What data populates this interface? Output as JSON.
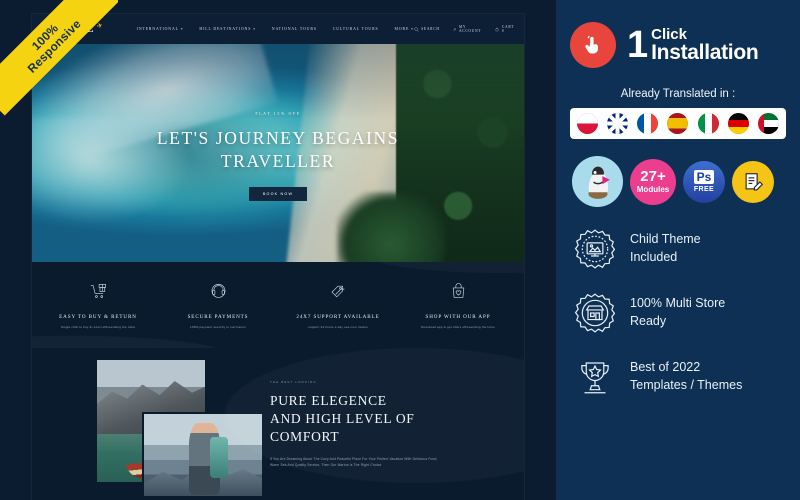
{
  "ribbon": {
    "line1": "100%",
    "line2": "Responsive"
  },
  "preview": {
    "header": {
      "logo_text": "TRAVEL",
      "logo_sub": "ONLINE STORE",
      "logo_icon": "airplane-icon",
      "nav": [
        {
          "label": "INTERNATIONAL",
          "has_caret": true
        },
        {
          "label": "HILL DESTINATIONS",
          "has_caret": true
        },
        {
          "label": "NATIONAL TOURS",
          "has_caret": false
        },
        {
          "label": "CULTURAL TOURS",
          "has_caret": false
        },
        {
          "label": "MORE",
          "has_caret": true
        }
      ],
      "tools": [
        {
          "label": "SEARCH",
          "icon": "search-icon"
        },
        {
          "label": "MY ACCOUNT",
          "icon": "user-icon"
        },
        {
          "label": "CART 0",
          "icon": "cart-icon"
        }
      ]
    },
    "hero": {
      "kicker": "FLAT 15% OFF",
      "title_line1": "LET'S JOURNEY BEGAINS",
      "title_line2": "TRAVELLER",
      "button": "BOOK NOW"
    },
    "features": [
      {
        "icon": "cart-gift-icon",
        "title": "EASY TO BUY & RETURN",
        "desc": "Single click to buy & return efficeending the lutus"
      },
      {
        "icon": "headset-icon",
        "title": "SECURE PAYMENTS",
        "desc": "100% payment security in mel harum"
      },
      {
        "icon": "tags-icon",
        "title": "24X7 SUPPORT AVAILABLE",
        "desc": "support 24 hours a day sea cum modus"
      },
      {
        "icon": "shopping-bag-heart-icon",
        "title": "SHOP WITH OUR APP",
        "desc": "Download app & get offers efficeending the lutus"
      }
    ],
    "about": {
      "kicker": "THE BEST LOOKING",
      "title_line1": "PURE ELEGENCE",
      "title_line2": "AND HIGH LEVEL OF",
      "title_line3": "COMFORT",
      "body": "If You Are Dreaming About The Cozy And Peaceful Place For Your Perfect Vacation With Delicious Food, Warm Sea And Quality Service, Then Our Marina Is The Right Choice.",
      "image1_alt": "mountain-lake-boat-photo",
      "image2_alt": "hiker-with-backpack-photo"
    }
  },
  "panel": {
    "background_color": "#0e3054",
    "one_click": {
      "icon": "click-hand-icon",
      "icon_bg": "#e8453c",
      "number": "1",
      "click_label": "Click",
      "installation_label": "Installation"
    },
    "translated_heading": "Already Translated in :",
    "flags": [
      {
        "name": "poland-flag",
        "label": "Poland"
      },
      {
        "name": "united-kingdom-flag",
        "label": "United Kingdom"
      },
      {
        "name": "france-flag",
        "label": "France"
      },
      {
        "name": "spain-flag",
        "label": "Spain"
      },
      {
        "name": "italy-flag",
        "label": "Italy"
      },
      {
        "name": "germany-flag",
        "label": "Germany"
      },
      {
        "name": "uae-flag",
        "label": "United Arab Emirates"
      }
    ],
    "badges": [
      {
        "name": "prestashop-badge",
        "color": "#a8dced",
        "text": ""
      },
      {
        "name": "modules-badge",
        "color": "#ec3d8e",
        "count": "27+",
        "text": "Modules"
      },
      {
        "name": "photoshop-free-badge",
        "color": "#2a52be",
        "ps": "Ps",
        "text": "FREE"
      },
      {
        "name": "editable-badge",
        "color": "#f5c515",
        "text": ""
      }
    ],
    "features": [
      {
        "icon": "child-theme-seal-icon",
        "line1": "Child Theme",
        "line2": "Included"
      },
      {
        "icon": "multi-store-seal-icon",
        "line1": "100% Multi Store",
        "line2": "Ready"
      },
      {
        "icon": "trophy-icon",
        "line1": "Best of 2022",
        "line2": "Templates / Themes"
      }
    ]
  }
}
